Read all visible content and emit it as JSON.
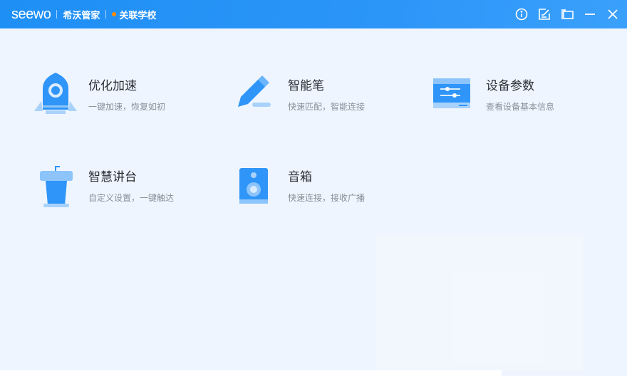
{
  "titlebar": {
    "logo": "seewo",
    "app_name": "希沃管家",
    "school": "关联学校",
    "dot_color": "#ff8a00",
    "controls": [
      "info-icon",
      "feedback-icon",
      "screen-icon",
      "minimize-icon",
      "close-icon"
    ]
  },
  "features": [
    {
      "title": "优化加速",
      "subtitle": "一键加速，恢复如初",
      "icon": "rocket-icon"
    },
    {
      "title": "智能笔",
      "subtitle": "快速匹配，智能连接",
      "icon": "pen-icon"
    },
    {
      "title": "设备参数",
      "subtitle": "查看设备基本信息",
      "icon": "device-settings-icon"
    },
    {
      "title": "智慧讲台",
      "subtitle": "自定义设置，一键触达",
      "icon": "podium-icon"
    },
    {
      "title": "音箱",
      "subtitle": "快速连接，接收广播",
      "icon": "speaker-icon"
    }
  ]
}
